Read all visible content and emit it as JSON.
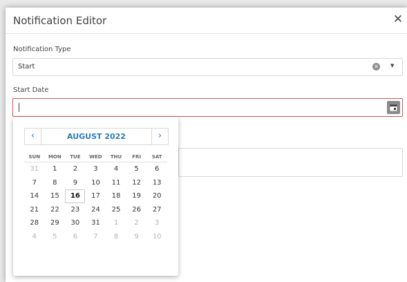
{
  "dialog": {
    "title": "Notification Editor",
    "close_icon": "close-icon"
  },
  "notification_type": {
    "label": "Notification Type",
    "value": "Start",
    "clear_icon": "clear-icon",
    "dropdown_icon": "caret-down-icon"
  },
  "start_date": {
    "label": "Start Date",
    "value": "",
    "calendar_icon": "calendar-icon",
    "border_color": "#d9534f"
  },
  "calendar": {
    "month_title": "AUGUST 2022",
    "prev_icon": "chevron-left-icon",
    "next_icon": "chevron-right-icon",
    "weekdays": [
      "SUN",
      "MON",
      "TUE",
      "WED",
      "THU",
      "FRI",
      "SAT"
    ],
    "weeks": [
      [
        {
          "d": "31",
          "other": true
        },
        {
          "d": "1"
        },
        {
          "d": "2"
        },
        {
          "d": "3"
        },
        {
          "d": "4"
        },
        {
          "d": "5"
        },
        {
          "d": "6"
        }
      ],
      [
        {
          "d": "7"
        },
        {
          "d": "8"
        },
        {
          "d": "9"
        },
        {
          "d": "10"
        },
        {
          "d": "11"
        },
        {
          "d": "12"
        },
        {
          "d": "13"
        }
      ],
      [
        {
          "d": "14"
        },
        {
          "d": "15"
        },
        {
          "d": "16",
          "today": true
        },
        {
          "d": "17"
        },
        {
          "d": "18"
        },
        {
          "d": "19"
        },
        {
          "d": "20"
        }
      ],
      [
        {
          "d": "21"
        },
        {
          "d": "22"
        },
        {
          "d": "23"
        },
        {
          "d": "24"
        },
        {
          "d": "25"
        },
        {
          "d": "26"
        },
        {
          "d": "27"
        }
      ],
      [
        {
          "d": "28"
        },
        {
          "d": "29"
        },
        {
          "d": "30"
        },
        {
          "d": "31"
        },
        {
          "d": "1",
          "other": true
        },
        {
          "d": "2",
          "other": true
        },
        {
          "d": "3",
          "other": true
        }
      ],
      [
        {
          "d": "4",
          "other": true
        },
        {
          "d": "5",
          "other": true
        },
        {
          "d": "6",
          "other": true
        },
        {
          "d": "7",
          "other": true
        },
        {
          "d": "8",
          "other": true
        },
        {
          "d": "9",
          "other": true
        },
        {
          "d": "10",
          "other": true
        }
      ]
    ],
    "accent": "#2b7bb9"
  }
}
